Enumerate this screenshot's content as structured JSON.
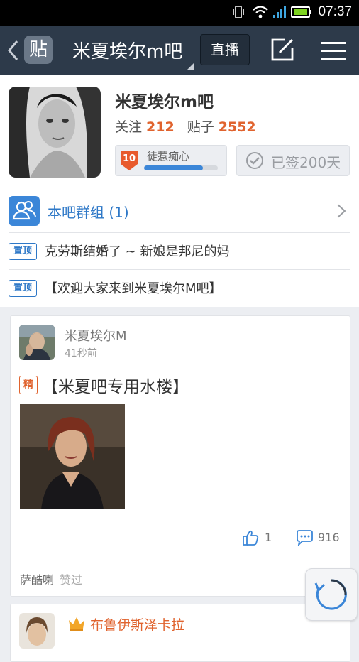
{
  "status_bar": {
    "time": "07:37"
  },
  "nav": {
    "logo": "贴",
    "title": "米夏埃尔m吧",
    "live_label": "直播"
  },
  "forum": {
    "name": "米夏埃尔m吧",
    "follow_label": "关注",
    "follow_count": "212",
    "posts_label": "贴子",
    "posts_count": "2552",
    "level_num": "10",
    "level_name": "徒惹痴心",
    "level_progress": 0.8,
    "signed_label": "已签200天"
  },
  "group": {
    "label": "本吧群组 (1)"
  },
  "pinned": [
    {
      "tag": "置顶",
      "text": "克劳斯结婚了 ~ 新娘是邦尼的妈"
    },
    {
      "tag": "置顶",
      "text": "【欢迎大家来到米夏埃尔M吧】"
    }
  ],
  "post": {
    "author": "米夏埃尔M",
    "time": "41秒前",
    "tag": "精",
    "title": "【米夏吧专用水楼】",
    "likes": "1",
    "comments": "916",
    "liker": "萨酷喇",
    "liker_suffix": "赞过"
  },
  "post2": {
    "author": "布鲁伊斯泽卡拉"
  },
  "colors": {
    "nav_bg": "#2d3a4a",
    "accent_blue": "#2e78c7",
    "accent_orange": "#e0632e"
  }
}
